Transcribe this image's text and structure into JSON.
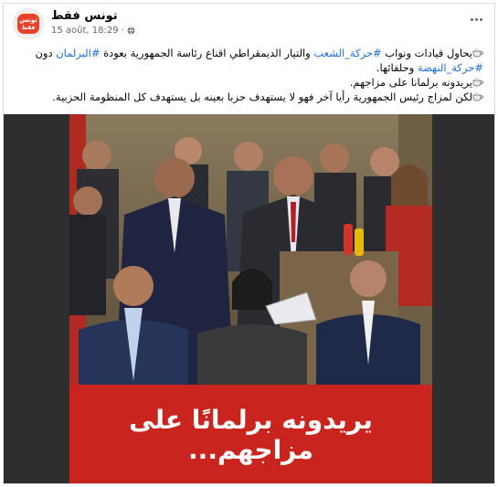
{
  "post": {
    "page_name": "تونس فقط",
    "timestamp": "15 août, 18:29",
    "separator": "·",
    "avatar_text_top": "تونس",
    "avatar_text_bottom": "فقط",
    "body": {
      "line1_prefix": "يحاول قيادات ونواب ",
      "line1_tag1": "#حركة_الشعب",
      "line1_mid": " والتيار الديمقراطي اقناع رئاسة الجمهورية بعودة ",
      "line1_tag2": "#البرلمان",
      "line1_suffix": " دون",
      "line2_tag": "#حركة_النهضة",
      "line2_suffix": " وحلفائها.",
      "line3": "يريدونه برلمانا على مزاجهم.",
      "line4": "لكن لمزاج رئيس الجمهورية رأيا آخر فهو لا يستهدف حزبا بعينه بل يستهدف كل المنظومة الحزبية."
    },
    "image_caption": "يريدونه برلمانًا على مزاجهم..."
  },
  "colors": {
    "link": "#216fdb",
    "image_background": "#c9241d",
    "media_frame": "#2e2e2e",
    "meta_text": "#65676b"
  },
  "icons": [
    "globe-icon",
    "more-options-icon",
    "coffee-cup-icon"
  ]
}
